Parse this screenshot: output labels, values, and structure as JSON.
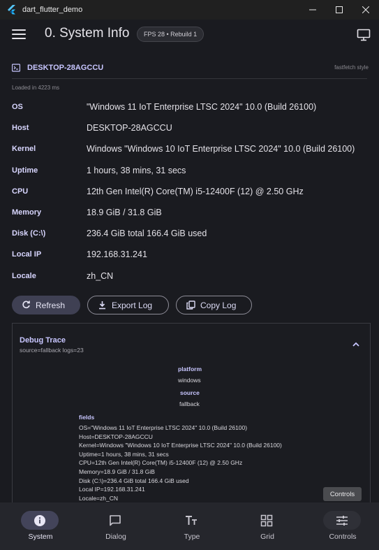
{
  "window": {
    "title": "dart_flutter_demo"
  },
  "appbar": {
    "title": "0. System Info",
    "badge": "FPS 28  •  Rebuild 1"
  },
  "card": {
    "hostname": "DESKTOP-28AGCCU",
    "style_tag": "fastfetch style",
    "loaded": "Loaded in 4223 ms"
  },
  "info": [
    {
      "key": "OS",
      "value": "\"Windows 11 IoT Enterprise LTSC 2024\" 10.0 (Build 26100)"
    },
    {
      "key": "Host",
      "value": "DESKTOP-28AGCCU"
    },
    {
      "key": "Kernel",
      "value": "Windows \"Windows 10 IoT Enterprise LTSC 2024\" 10.0 (Build 26100)"
    },
    {
      "key": "Uptime",
      "value": "1 hours, 38 mins, 31 secs"
    },
    {
      "key": "CPU",
      "value": "12th Gen Intel(R) Core(TM) i5-12400F (12) @ 2.50 GHz"
    },
    {
      "key": "Memory",
      "value": "18.9 GiB / 31.8 GiB"
    },
    {
      "key": "Disk (C:\\)",
      "value": "236.4 GiB total 166.4 GiB used"
    },
    {
      "key": "Local IP",
      "value": "192.168.31.241"
    },
    {
      "key": "Locale",
      "value": "zh_CN"
    }
  ],
  "buttons": {
    "refresh": "Refresh",
    "export": "Export Log",
    "copy": "Copy Log"
  },
  "debug": {
    "title": "Debug Trace",
    "subtitle": "source=fallback  logs=23",
    "platform_label": "platform",
    "platform_value": "windows",
    "source_label": "source",
    "source_value": "fallback",
    "fields_label": "fields",
    "fields": [
      "OS=\"Windows 11 IoT Enterprise LTSC 2024\" 10.0 (Build 26100)",
      "Host=DESKTOP-28AGCCU",
      "Kernel=Windows \"Windows 10 IoT Enterprise LTSC 2024\" 10.0 (Build 26100)",
      "Uptime=1 hours, 38 mins, 31 secs",
      "CPU=12th Gen Intel(R) Core(TM) i5-12400F (12) @ 2.50 GHz",
      "Memory=18.9 GiB / 31.8 GiB",
      "Disk (C:\\)=236.4 GiB total 166.4 GiB used",
      "Local IP=192.168.31.241",
      "Locale=zh_CN"
    ]
  },
  "tooltip": "Controls",
  "nav": [
    "System",
    "Dialog",
    "Type",
    "Grid",
    "Controls"
  ],
  "colors": {
    "accent": "#c8c6ff",
    "active_pill": "#43445a",
    "background": "#1a1b20"
  }
}
